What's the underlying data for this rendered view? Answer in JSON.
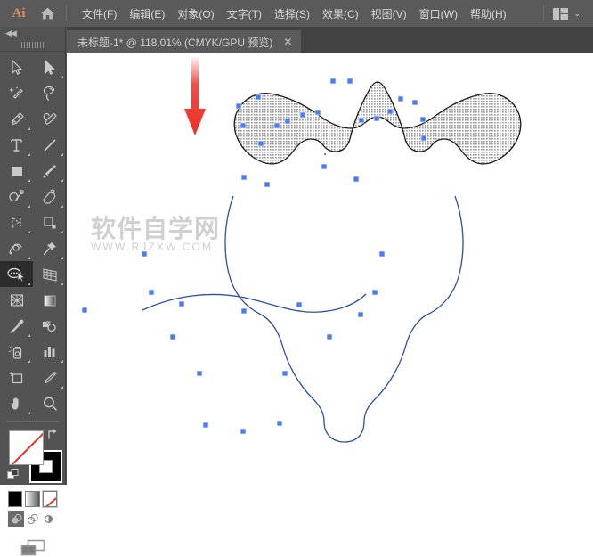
{
  "app": {
    "name": "Ai",
    "logo_color": "#d98c5f",
    "ui_bg": "#535353",
    "menubar_bg": "#5a5a5a",
    "tabbar_bg": "#434343",
    "canvas_bg": "#ffffff",
    "accent_blue": "#3366dd",
    "arrow_red": "#ee2d24"
  },
  "menubar": {
    "home_icon": "home-icon",
    "items": [
      {
        "label": "文件(F)",
        "name": "menu-file"
      },
      {
        "label": "编辑(E)",
        "name": "menu-edit"
      },
      {
        "label": "对象(O)",
        "name": "menu-object"
      },
      {
        "label": "文字(T)",
        "name": "menu-type"
      },
      {
        "label": "选择(S)",
        "name": "menu-select"
      },
      {
        "label": "效果(C)",
        "name": "menu-effect"
      },
      {
        "label": "视图(V)",
        "name": "menu-view"
      },
      {
        "label": "窗口(W)",
        "name": "menu-window"
      },
      {
        "label": "帮助(H)",
        "name": "menu-help"
      }
    ],
    "workspace_icon": "workspace-layout-icon",
    "workspace_chevron": "⌄"
  },
  "tabbar": {
    "tab_title": "未标题-1* @ 118.01% (CMYK/GPU 预览)",
    "close_glyph": "✕",
    "document_name": "未标题-1*",
    "zoom_level": "118.01%",
    "color_mode": "CMYK/GPU",
    "view_mode": "预览"
  },
  "toolbar": {
    "collapse_glyph": "◀◀",
    "tools": [
      {
        "name": "selection-tool",
        "has_flyout": false
      },
      {
        "name": "direct-selection-tool",
        "has_flyout": true
      },
      {
        "name": "magic-wand-tool",
        "has_flyout": false
      },
      {
        "name": "lasso-tool",
        "has_flyout": false
      },
      {
        "name": "pen-tool",
        "has_flyout": true
      },
      {
        "name": "curvature-tool",
        "has_flyout": false
      },
      {
        "name": "type-tool",
        "has_flyout": true
      },
      {
        "name": "line-segment-tool",
        "has_flyout": true
      },
      {
        "name": "rectangle-tool",
        "has_flyout": true
      },
      {
        "name": "paintbrush-tool",
        "has_flyout": true
      },
      {
        "name": "shaper-tool",
        "has_flyout": true
      },
      {
        "name": "eraser-tool",
        "has_flyout": true
      },
      {
        "name": "rotate-tool",
        "has_flyout": true
      },
      {
        "name": "scale-tool",
        "has_flyout": true
      },
      {
        "name": "width-tool",
        "has_flyout": true
      },
      {
        "name": "free-transform-tool",
        "has_flyout": true
      },
      {
        "name": "shape-builder-tool",
        "has_flyout": true,
        "active": true
      },
      {
        "name": "perspective-grid-tool",
        "has_flyout": true
      },
      {
        "name": "mesh-tool",
        "has_flyout": false
      },
      {
        "name": "gradient-tool",
        "has_flyout": false
      },
      {
        "name": "eyedropper-tool",
        "has_flyout": true
      },
      {
        "name": "blend-tool",
        "has_flyout": false
      },
      {
        "name": "symbol-sprayer-tool",
        "has_flyout": true
      },
      {
        "name": "column-graph-tool",
        "has_flyout": true
      },
      {
        "name": "artboard-tool",
        "has_flyout": false
      },
      {
        "name": "slice-tool",
        "has_flyout": true
      },
      {
        "name": "hand-tool",
        "has_flyout": true
      },
      {
        "name": "zoom-tool",
        "has_flyout": false
      }
    ],
    "fill_color": "#ffffff",
    "fill_is_none": true,
    "stroke_color": "#000000",
    "swap_icon": "swap-fill-stroke-icon",
    "default_icon": "default-fill-stroke-icon",
    "color_modes": [
      {
        "name": "color-swatch-button",
        "selected": false
      },
      {
        "name": "gradient-swatch-button",
        "selected": false
      },
      {
        "name": "none-swatch-button",
        "selected": true
      }
    ],
    "draw_modes": [
      {
        "name": "draw-normal-button",
        "active": true
      },
      {
        "name": "draw-behind-button",
        "active": false
      },
      {
        "name": "draw-inside-button",
        "active": false
      }
    ],
    "screen_mode": {
      "name": "change-screen-mode-button"
    }
  },
  "canvas": {
    "watermark_cn": "软件自学网",
    "watermark_en": "WWW.RJZXW.COM",
    "artwork_name": "strawberry-path-artwork",
    "path_stroke": "#2b4fa8",
    "selection_color": "#3366dd",
    "leaf_fill_pattern": "dotted-halftone",
    "annotation_arrow": {
      "name": "red-down-arrow-annotation",
      "color": "#ee2d24",
      "direction": "down"
    },
    "anchor_points_visible": true
  }
}
